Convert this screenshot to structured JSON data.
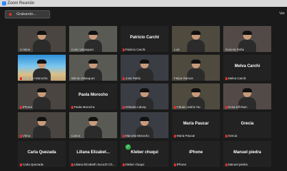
{
  "window": {
    "title": "Zoom Reunión"
  },
  "toolbar": {
    "recording_label": "Grabando...",
    "view_label": "Ver"
  },
  "tiles": [
    {
      "label": "Cristian",
      "video": true
    },
    {
      "label": "Carla Velasquez",
      "video": true
    },
    {
      "name": "Patricio Carchi",
      "label": "Patricio Carchi",
      "muted": true
    },
    {
      "label": "Luis",
      "video": true
    },
    {
      "label": "Daniela Peña",
      "video": true
    },
    {
      "label": "Christian Morocho",
      "muted": true,
      "video": true,
      "beach": true
    },
    {
      "label": "Wilma Velasquez",
      "video": true
    },
    {
      "label": "Jose Pablo",
      "muted": true,
      "video": true
    },
    {
      "label": "Felipe Ramon",
      "video": true,
      "active": true
    },
    {
      "name": "Melva Carchi",
      "label": "Melva Carchi",
      "muted": true
    },
    {
      "label": "iPhone",
      "muted": true,
      "video": true
    },
    {
      "name": "Paola Morocho",
      "label": "Paola Morocho",
      "muted": true
    },
    {
      "label": "Orlando Lalvay",
      "muted": true,
      "video": true
    },
    {
      "label": "Fabian Jabón Ou",
      "muted": true,
      "video": true
    },
    {
      "label": "Rosa Elf Ram",
      "muted": true,
      "video": true
    },
    {
      "label": "Vilma",
      "muted": true,
      "video": true
    },
    {
      "label": "Carlos",
      "video": true
    },
    {
      "label": "Marcela Morocho",
      "muted": true,
      "video": true
    },
    {
      "name": "Maria Paucar",
      "label": "Maria Paucar",
      "muted": true
    },
    {
      "name": "Grecia",
      "label": "Grecia",
      "muted": true
    },
    {
      "name": "Carla Quezada",
      "label": "Carla Quezada",
      "muted": true
    },
    {
      "name": "Liliana  Elizabet...",
      "label": "Liliana Elizabeth Sucuzh Ch...",
      "muted": true
    },
    {
      "name": "Kleber chuqui",
      "label": "Kleber chuqui",
      "muted": true
    },
    {
      "name": "iPhone",
      "label": "iPhone",
      "muted": true
    },
    {
      "name": "Manuel piedra",
      "label": "Manuel piedra",
      "muted": true
    }
  ]
}
